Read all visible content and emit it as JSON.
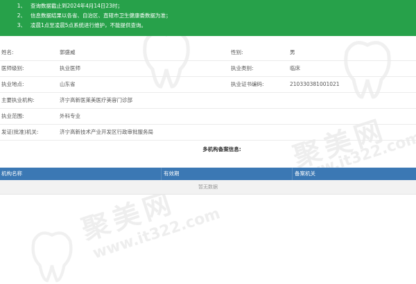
{
  "notice": [
    {
      "num": "1、",
      "text": "查询数据截止到2024年4月14日23时；"
    },
    {
      "num": "2、",
      "text": "信息数据结果以各省、自治区、直辖市卫生健康委数据为准；"
    },
    {
      "num": "3、",
      "text": "凌晨1点至凌晨5点系统进行维护，不能提供查询。"
    }
  ],
  "info": {
    "name_label": "姓名:",
    "name_value": "郭盛威",
    "gender_label": "性别:",
    "gender_value": "男",
    "level_label": "医师级别:",
    "level_value": "执业医师",
    "category_label": "执业类别:",
    "category_value": "临床",
    "location_label": "执业地点:",
    "location_value": "山东省",
    "cert_label": "执业证书编码:",
    "cert_value": "210330381001021",
    "institution_label": "主要执业机构:",
    "institution_value": "济宁高新医莱美医疗美容门诊部",
    "scope_label": "执业范围:",
    "scope_value": "外科专业",
    "authority_label": "发证(批准)机关:",
    "authority_value": "济宁高新技术产业开发区行政审批服务局"
  },
  "multi": {
    "title": "多机构备案信息:",
    "columns": [
      "机构名称",
      "有效期",
      "备案机关"
    ],
    "empty_text": "暂无数据"
  },
  "watermark": {
    "brand": "聚美网",
    "url": "www.it322.com"
  }
}
